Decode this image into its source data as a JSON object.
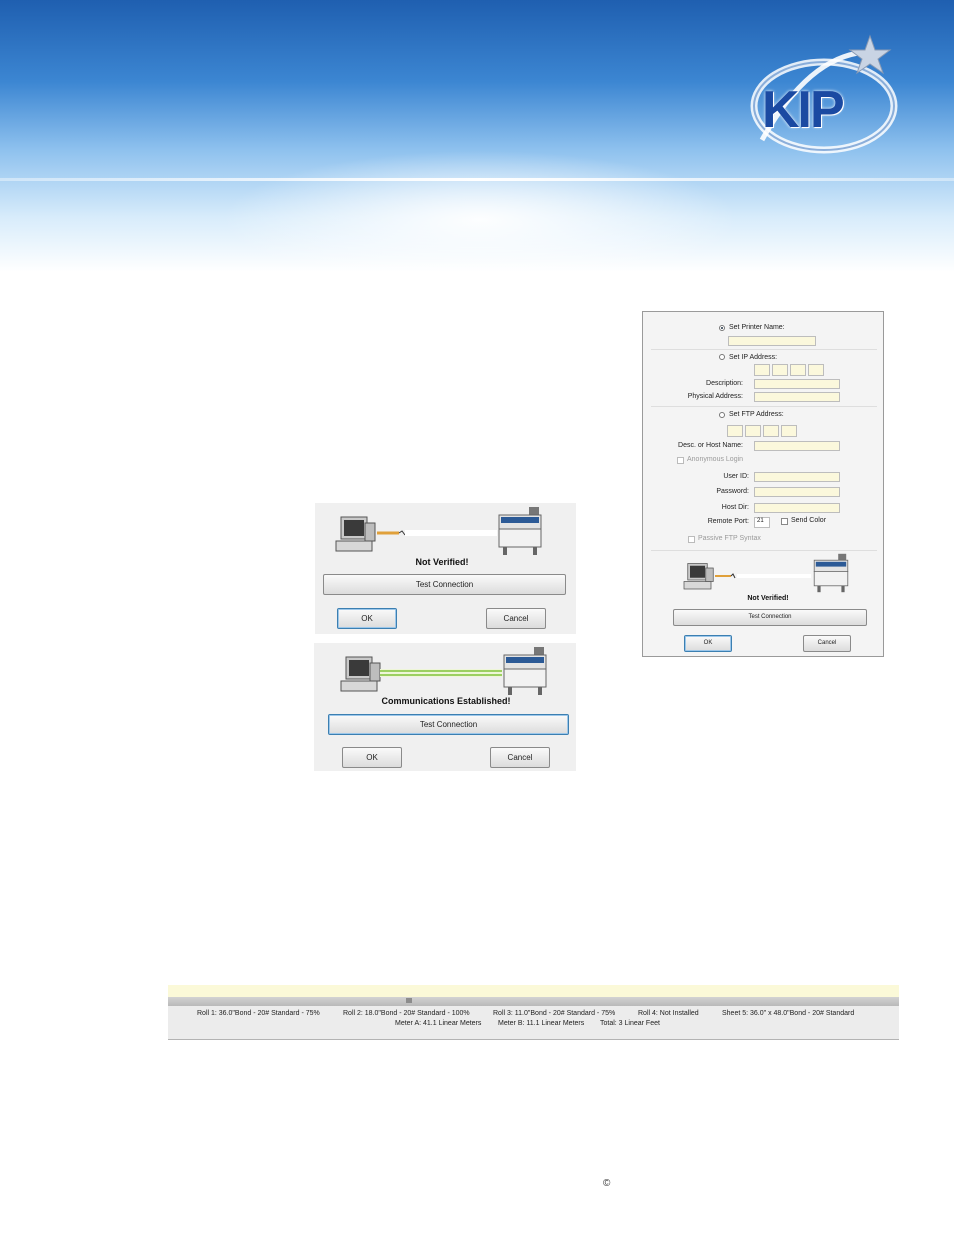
{
  "brand": {
    "logo_text": "KIP"
  },
  "dialog_not_verified": {
    "status": "Not Verified!",
    "test_button": "Test Connection",
    "ok_button": "OK",
    "cancel_button": "Cancel"
  },
  "dialog_established": {
    "status": "Communications Established!",
    "test_button": "Test Connection",
    "ok_button": "OK",
    "cancel_button": "Cancel"
  },
  "settings_panel": {
    "set_printer_name": "Set Printer Name:",
    "set_ip_address": "Set IP Address:",
    "description": "Description:",
    "physical_address": "Physical Address:",
    "set_ftp_address": "Set FTP Address:",
    "desc_or_host_name": "Desc. or Host Name:",
    "anonymous_login": "Anonymous Login",
    "user_id": "User ID:",
    "password": "Password:",
    "host_dir": "Host Dir:",
    "remote_port": "Remote Port:",
    "remote_port_value": "21",
    "send_color": "Send Color",
    "passive_ftp_syntax": "Passive FTP Syntax",
    "status": "Not Verified!",
    "test_button": "Test Connection",
    "ok_button": "OK",
    "cancel_button": "Cancel"
  },
  "status_bar": {
    "roll1": "Roll 1: 36.0\"Bond - 20# Standard - 75%",
    "roll2": "Roll 2: 18.0\"Bond - 20# Standard - 100%",
    "roll3": "Roll 3: 11.0\"Bond - 20# Standard - 75%",
    "roll4": "Roll 4: Not Installed",
    "sheet5": "Sheet 5: 36.0\" x 48.0\"Bond - 20# Standard",
    "meter_a": "Meter A: 41.1 Linear Meters",
    "meter_b": "Meter B: 11.1 Linear Meters",
    "total": "Total: 3 Linear Feet"
  },
  "footer": {
    "copyright": "©"
  }
}
